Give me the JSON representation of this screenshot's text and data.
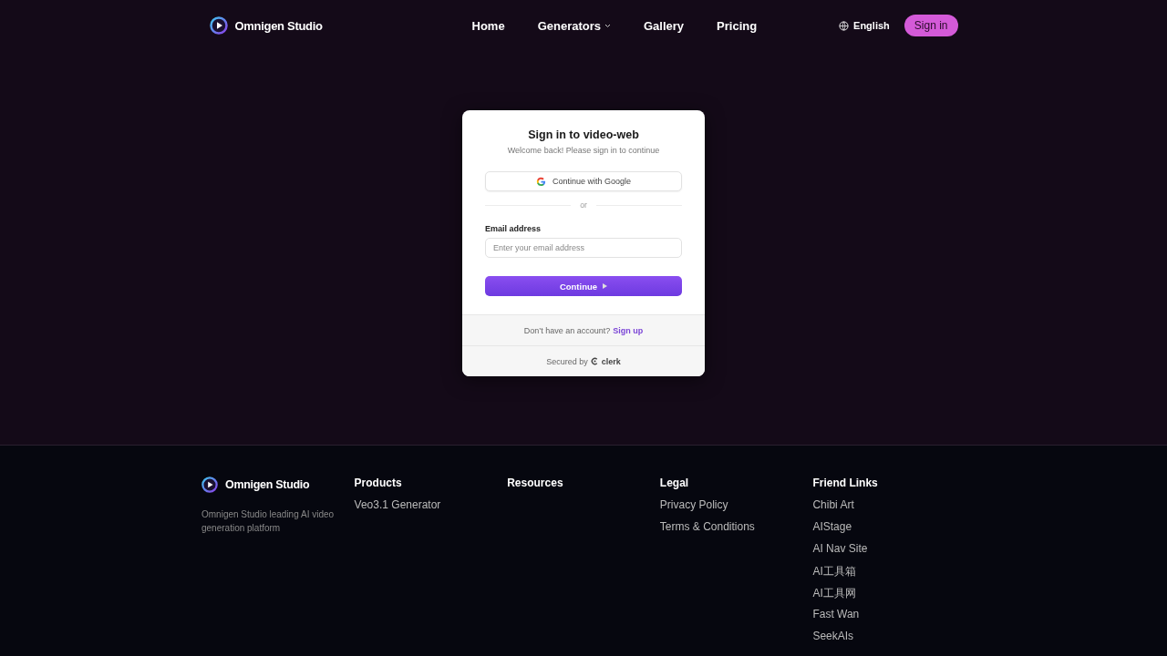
{
  "header": {
    "brand": "Omnigen Studio",
    "nav": [
      {
        "label": "Home",
        "dropdown": false
      },
      {
        "label": "Generators",
        "dropdown": true
      },
      {
        "label": "Gallery",
        "dropdown": false
      },
      {
        "label": "Pricing",
        "dropdown": false
      }
    ],
    "language": "English",
    "sign_in": "Sign in"
  },
  "card": {
    "title": "Sign in to video-web",
    "subtitle": "Welcome back! Please sign in to continue",
    "google": "Continue with Google",
    "divider": "or",
    "email_label": "Email address",
    "email_placeholder": "Enter your email address",
    "continue": "Continue",
    "no_account": "Don’t have an account?",
    "sign_up": "Sign up",
    "secured_by": "Secured by",
    "clerk": "clerk"
  },
  "footer": {
    "brand": "Omnigen Studio",
    "tagline": "Omnigen Studio leading AI video generation platform",
    "columns": [
      {
        "title": "Products",
        "links": [
          "Veo3.1 Generator"
        ]
      },
      {
        "title": "Resources"
      },
      {
        "title": "Legal",
        "links": [
          "Privacy Policy",
          "Terms & Conditions"
        ]
      },
      {
        "title": "Friend Links",
        "links": [
          "Chibi Art",
          "AIStage",
          "AI Nav Site",
          "AI工具箱",
          "AI工具网",
          "Fast Wan",
          "SeekAIs"
        ]
      }
    ]
  }
}
